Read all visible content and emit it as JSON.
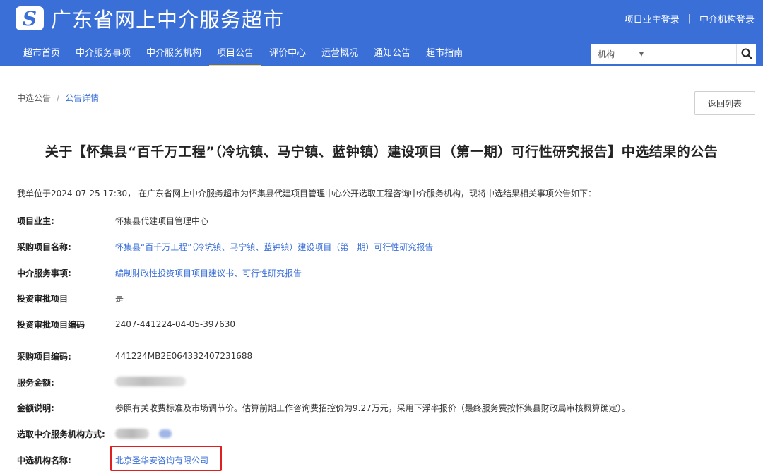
{
  "header": {
    "logo_glyph": "S",
    "site_title": "广东省网上中介服务超市",
    "links": [
      "项目业主登录",
      "中介机构登录"
    ],
    "separator": "|",
    "bg_color": "#3a6fd8"
  },
  "nav": {
    "items": [
      {
        "label": "超市首页"
      },
      {
        "label": "中介服务事项"
      },
      {
        "label": "中介服务机构"
      },
      {
        "label": "项目公告",
        "active": true
      },
      {
        "label": "评价中心"
      },
      {
        "label": "运营概况"
      },
      {
        "label": "通知公告"
      },
      {
        "label": "超市指南"
      }
    ]
  },
  "search": {
    "select_value": "机构",
    "placeholder": "",
    "icon": "search-icon"
  },
  "breadcrumb": {
    "root": "中选公告",
    "separator": "/",
    "current": "公告详情"
  },
  "back_button": "返回列表",
  "title": "关于【怀集县“百千万工程”（冷坑镇、马宁镇、蓝钟镇）建设项目（第一期）可行性研究报告】中选结果的公告",
  "intro": "我单位于2024-07-25 17:30， 在广东省网上中介服务超市为怀集县代建项目管理中心公开选取工程咨询中介服务机构，现将中选结果相关事项公告如下：",
  "fields": [
    {
      "label": "项目业主:",
      "value": "怀集县代建项目管理中心"
    },
    {
      "label": "采购项目名称:",
      "value": "怀集县“百千万工程”（冷坑镇、马宁镇、蓝钟镇）建设项目（第一期）可行性研究报告"
    },
    {
      "label": "中介服务事项:",
      "value": "编制财政性投资项目项目建议书、可行性研究报告"
    },
    {
      "label": "投资审批项目",
      "value": "是"
    },
    {
      "label": "投资审批项目编码",
      "value": "2407-441224-04-05-397630"
    },
    {
      "label": "采购项目编码:",
      "value": "441224MB2E064332407231688"
    },
    {
      "label": "服务金额:",
      "value": ""
    },
    {
      "label": "金额说明:",
      "value": "参照有关收费标准及市场调节价。估算前期工作咨询费招控价为9.27万元，采用下浮率报价（最终服务费按怀集县财政局审核概算确定）。"
    },
    {
      "label": "选取中介服务机构方式:",
      "value": ""
    },
    {
      "label": "中选机构名称:",
      "value": "北京圣华安咨询有限公司"
    }
  ],
  "highlight_color": "#e02020"
}
